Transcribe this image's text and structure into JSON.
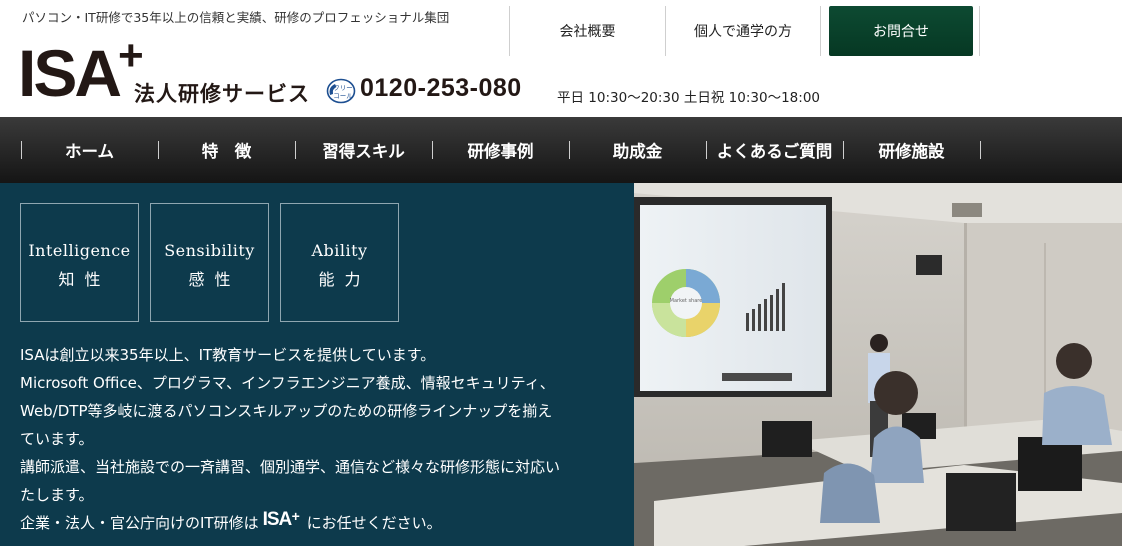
{
  "header": {
    "tagline": "パソコン・IT研修で35年以上の信頼と実績、研修のプロフェッショナル集団",
    "logo_text": "ISA",
    "logo_plus": "+",
    "service_name": "法人研修サービス",
    "phone_icon_label": "フリーコール",
    "phone_number": "0120-253-080",
    "hours": "平日 10:30〜20:30 土日祝 10:30〜18:00",
    "links": {
      "company": "会社概要",
      "individual": "個人で通学の方"
    },
    "contact_label": "お問合せ"
  },
  "nav": {
    "items": [
      "ホーム",
      "特　徴",
      "習得スキル",
      "研修事例",
      "助成金",
      "よくあるご質問",
      "研修施設"
    ]
  },
  "values": [
    {
      "en": "Intelligence",
      "ja": "知性"
    },
    {
      "en": "Sensibility",
      "ja": "感性"
    },
    {
      "en": "Ability",
      "ja": "能力"
    }
  ],
  "intro": {
    "lines": [
      "ISAは創立以来35年以上、IT教育サービスを提供しています。",
      "Microsoft Office、プログラマ、インフラエンジニア養成、情報セキュリティ、",
      "Web/DTP等多岐に渡るパソコンスキルアップのための研修ラインナップを揃え",
      "ています。",
      "講師派遣、当社施設での一斉講習、個別通学、通信など様々な研修形態に対応い",
      "たします。"
    ],
    "last_prefix": "企業・法人・官公庁向けのIT研修は",
    "last_logo": "ISA",
    "last_suffix": "にお任せください。"
  },
  "photo": {
    "slide_title": "Market share"
  },
  "colors": {
    "panel_bg": "#0d3a4c",
    "contact_bg": "#063823",
    "nav_bg": "#1e1e1e"
  }
}
